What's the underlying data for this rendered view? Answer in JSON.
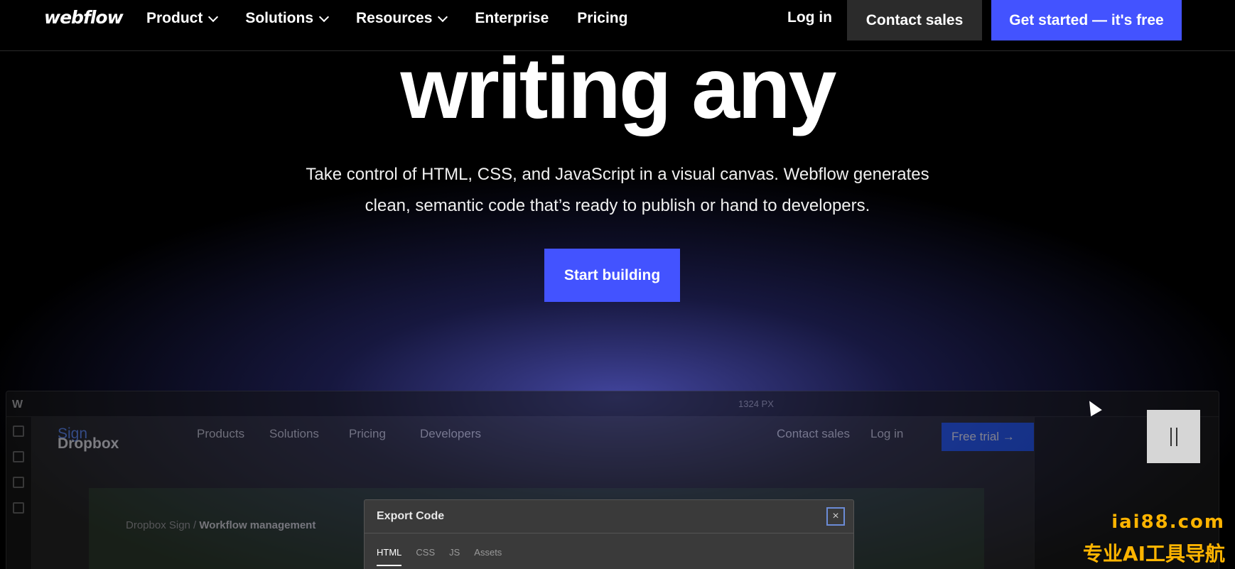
{
  "nav": {
    "logo": "webflow",
    "items": [
      {
        "label": "Product",
        "dropdown": true
      },
      {
        "label": "Solutions",
        "dropdown": true
      },
      {
        "label": "Resources",
        "dropdown": true
      },
      {
        "label": "Enterprise",
        "dropdown": false
      },
      {
        "label": "Pricing",
        "dropdown": false
      }
    ],
    "login": "Log in",
    "contact": "Contact sales",
    "get_started": "Get started — it's free"
  },
  "hero": {
    "headline": "writing any",
    "subtext_line1": "Take control of HTML, CSS, and JavaScript in a visual canvas. Webflow generates",
    "subtext_line2": "clean, semantic code that’s ready to publish or hand to developers.",
    "cta": "Start building"
  },
  "designer": {
    "topbar_zoom": "1324 PX",
    "site": {
      "brand_main": "Dropbox",
      "brand_accent": "Sign",
      "nav_items": [
        "Products",
        "Solutions",
        "Pricing",
        "Developers"
      ],
      "contact": "Contact sales",
      "login": "Log in",
      "trial": "Free trial  →",
      "crumb_prefix": "Dropbox Sign /",
      "crumb_current": "Workflow management"
    },
    "export_dialog": {
      "title": "Export Code",
      "close": "×",
      "tabs": [
        "HTML",
        "CSS",
        "JS",
        "Assets"
      ],
      "active_tab": "HTML"
    }
  },
  "watermark": {
    "line1": "iai88.com",
    "line2": "专业AI工具导航"
  },
  "colors": {
    "accent": "#4353ff",
    "background": "#000000",
    "watermark": "#ffb400"
  }
}
